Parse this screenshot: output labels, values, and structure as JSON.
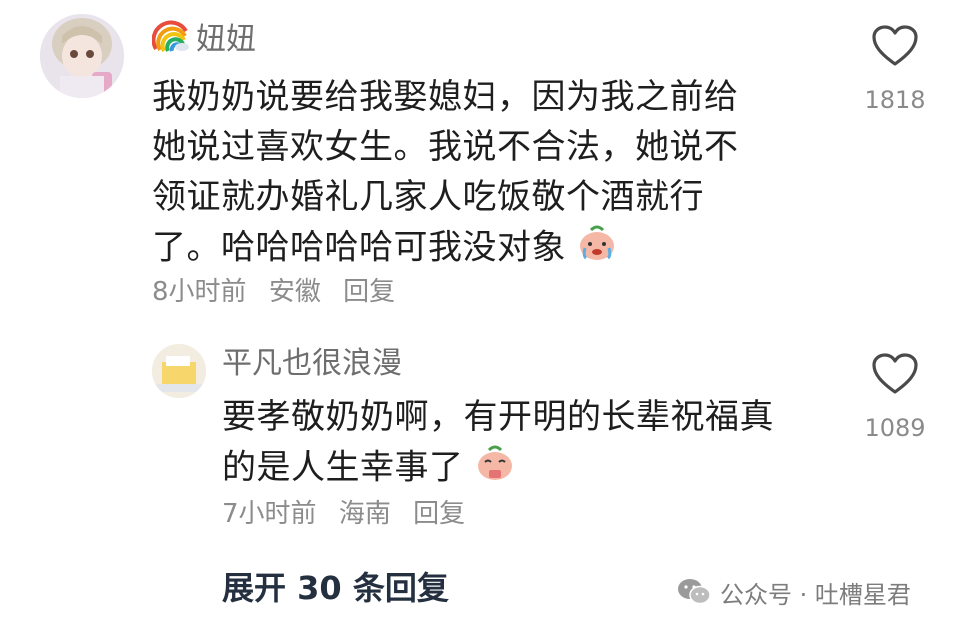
{
  "comment": {
    "author": "妞妞",
    "text_lines": [
      "我奶奶说要给我娶媳妇，因为我之前给",
      "她说过喜欢女生。我说不合法，她说不",
      "领证就办婚礼几家人吃饭敬个酒就行",
      "了。哈哈哈哈哈可我没对象"
    ],
    "time": "8小时前",
    "location": "安徽",
    "reply_label": "回复",
    "like_count": "1818",
    "name_icon": "rainbow-icon",
    "emoji": "crying-face-emoji"
  },
  "reply": {
    "author": "平凡也很浪漫",
    "text_lines": [
      "要孝敬奶奶啊，有开明的长辈祝福真",
      "的是人生幸事了"
    ],
    "time": "7小时前",
    "location": "海南",
    "reply_label": "回复",
    "like_count": "1089",
    "emoji": "thankful-face-emoji"
  },
  "expand_label": "展开 30 条回复",
  "watermark": {
    "text": "公众号 · 吐槽星君",
    "icon": "wechat-icon"
  },
  "colors": {
    "text": "#1e1e1e",
    "secondary": "#8c8c8c",
    "expand": "#243040"
  }
}
